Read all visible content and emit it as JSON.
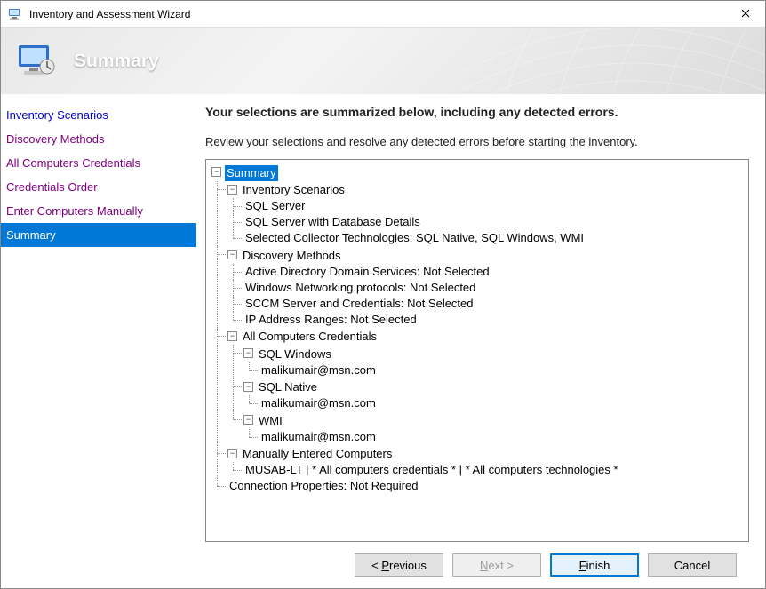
{
  "window": {
    "title": "Inventory and Assessment Wizard"
  },
  "banner": {
    "heading": "Summary"
  },
  "sidebar": {
    "items": [
      {
        "label": "Inventory Scenarios",
        "state": "link"
      },
      {
        "label": "Discovery Methods",
        "state": "visited"
      },
      {
        "label": "All Computers Credentials",
        "state": "visited"
      },
      {
        "label": "Credentials Order",
        "state": "visited"
      },
      {
        "label": "Enter Computers Manually",
        "state": "visited"
      },
      {
        "label": "Summary",
        "state": "active"
      }
    ]
  },
  "main": {
    "heading": "Your selections are summarized below, including any detected errors.",
    "instruction_prefix": "R",
    "instruction_rest": "eview your selections and resolve any detected errors before starting the inventory."
  },
  "tree": {
    "root": "Summary",
    "inventory_scenarios": {
      "label": "Inventory Scenarios",
      "items": [
        "SQL Server",
        "SQL Server with Database Details",
        "Selected Collector Technologies: SQL Native, SQL Windows, WMI"
      ]
    },
    "discovery_methods": {
      "label": "Discovery Methods",
      "items": [
        "Active Directory Domain Services: Not Selected",
        "Windows Networking protocols: Not Selected",
        "SCCM Server and Credentials: Not Selected",
        "IP Address Ranges: Not Selected"
      ]
    },
    "credentials": {
      "label": "All Computers Credentials",
      "groups": [
        {
          "name": "SQL Windows",
          "entries": [
            "malikumair@msn.com"
          ]
        },
        {
          "name": "SQL Native",
          "entries": [
            "malikumair@msn.com"
          ]
        },
        {
          "name": "WMI",
          "entries": [
            "malikumair@msn.com"
          ]
        }
      ]
    },
    "manual": {
      "label": "Manually Entered Computers",
      "items": [
        "MUSAB-LT | * All computers credentials * | * All computers technologies *"
      ]
    },
    "connection": "Connection Properties: Not Required"
  },
  "footer": {
    "previous_full": "< Previous",
    "previous_mn": "P",
    "previous_pre": "< ",
    "previous_post": "revious",
    "next_full": "Next >",
    "next_mn": "N",
    "next_post": "ext >",
    "finish_full": "Finish",
    "finish_mn": "F",
    "finish_post": "inish",
    "cancel": "Cancel"
  },
  "icons": {
    "minus": "−"
  }
}
